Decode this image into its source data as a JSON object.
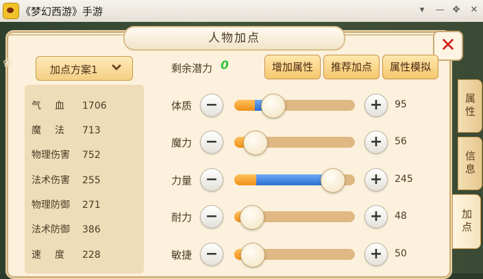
{
  "window": {
    "title": "《梦幻西游》手游",
    "buttons": [
      "▾",
      "—",
      "✥",
      "✕"
    ]
  },
  "panel": {
    "title": "人物加点",
    "close_label": "✕"
  },
  "plan": {
    "label": "加点方案1"
  },
  "stats": [
    {
      "name": "气血",
      "value": "1706"
    },
    {
      "name": "魔法",
      "value": "713"
    },
    {
      "name": "物理伤害",
      "value": "752"
    },
    {
      "name": "法术伤害",
      "value": "255"
    },
    {
      "name": "物理防御",
      "value": "271"
    },
    {
      "name": "法术防御",
      "value": "386"
    },
    {
      "name": "速度",
      "value": "228"
    }
  ],
  "potential": {
    "label": "剩余潜力",
    "value": "0"
  },
  "actions": [
    "增加属性",
    "推荐加点",
    "属性模拟"
  ],
  "attributes": [
    {
      "name": "体质",
      "value": "95",
      "orange_fraction": 0.17,
      "blue_fraction": 0.08,
      "knob_fraction": 0.32
    },
    {
      "name": "魔力",
      "value": "56",
      "orange_fraction": 0.17,
      "blue_fraction": 0.0,
      "knob_fraction": 0.17
    },
    {
      "name": "力量",
      "value": "245",
      "orange_fraction": 0.18,
      "blue_fraction": 0.63,
      "knob_fraction": 0.81
    },
    {
      "name": "耐力",
      "value": "48",
      "orange_fraction": 0.14,
      "blue_fraction": 0.0,
      "knob_fraction": 0.14
    },
    {
      "name": "敏捷",
      "value": "50",
      "orange_fraction": 0.15,
      "blue_fraction": 0.0,
      "knob_fraction": 0.15
    }
  ],
  "side_tabs": [
    {
      "label": "属性",
      "active": false
    },
    {
      "label": "信息",
      "active": false
    },
    {
      "label": "加点",
      "active": true
    }
  ]
}
